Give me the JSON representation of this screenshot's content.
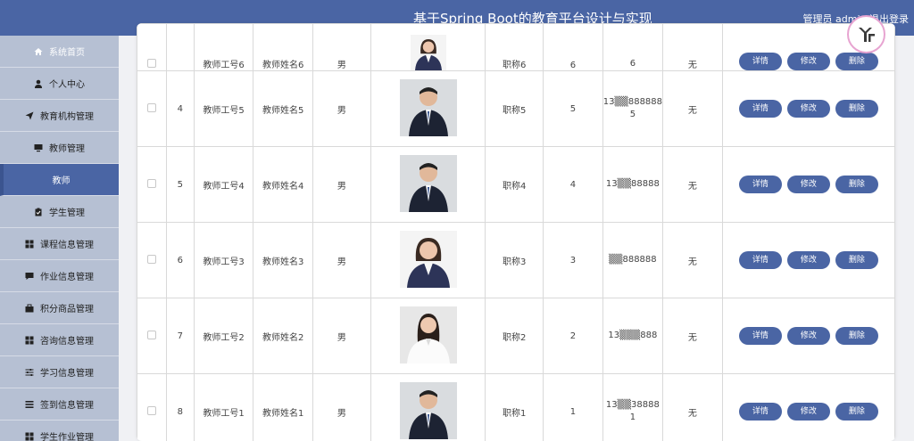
{
  "header": {
    "title": "基于Spring Boot的教育平台设计与实现",
    "user_text": "管理员 admin 退出登录"
  },
  "sidebar": {
    "items": [
      {
        "label": "系统首页",
        "icon": "home-icon"
      },
      {
        "label": "个人中心",
        "icon": "user-icon"
      },
      {
        "label": "教育机构管理",
        "icon": "send-icon"
      },
      {
        "label": "教师管理",
        "icon": "monitor-icon"
      },
      {
        "label": "教师",
        "icon": ""
      },
      {
        "label": "学生管理",
        "icon": "clipboard-icon"
      },
      {
        "label": "课程信息管理",
        "icon": "grid-icon"
      },
      {
        "label": "作业信息管理",
        "icon": "chat-icon"
      },
      {
        "label": "积分商品管理",
        "icon": "bag-icon"
      },
      {
        "label": "咨询信息管理",
        "icon": "grid-icon"
      },
      {
        "label": "学习信息管理",
        "icon": "sliders-icon"
      },
      {
        "label": "签到信息管理",
        "icon": "list-icon"
      },
      {
        "label": "学生作业管理",
        "icon": "grid-icon"
      }
    ]
  },
  "table": {
    "actions": {
      "detail": "详情",
      "edit": "修改",
      "delete": "删除"
    },
    "rows": [
      {
        "index": "",
        "id": "教师工号6",
        "name": "教师姓名6",
        "gender": "男",
        "title": "职称6",
        "level": "6",
        "phone_top": "",
        "phone_bottom": "6",
        "remark": "无",
        "photo": "female"
      },
      {
        "index": "4",
        "id": "教师工号5",
        "name": "教师姓名5",
        "gender": "男",
        "title": "职称5",
        "level": "5",
        "phone_top": "13▒▒888888",
        "phone_bottom": "5",
        "remark": "无",
        "photo": "male"
      },
      {
        "index": "5",
        "id": "教师工号4",
        "name": "教师姓名4",
        "gender": "男",
        "title": "职称4",
        "level": "4",
        "phone_top": "13▒▒88888",
        "phone_bottom": "",
        "remark": "无",
        "photo": "male"
      },
      {
        "index": "6",
        "id": "教师工号3",
        "name": "教师姓名3",
        "gender": "男",
        "title": "职称3",
        "level": "3",
        "phone_top": "▒▒888888",
        "phone_bottom": "",
        "remark": "无",
        "photo": "female"
      },
      {
        "index": "7",
        "id": "教师工号2",
        "name": "教师姓名2",
        "gender": "男",
        "title": "职称2",
        "level": "2",
        "phone_top": "13▒▒▒888",
        "phone_bottom": "",
        "remark": "无",
        "photo": "female-white"
      },
      {
        "index": "8",
        "id": "教师工号1",
        "name": "教师姓名1",
        "gender": "男",
        "title": "职称1",
        "level": "1",
        "phone_top": "13▒▒38888",
        "phone_bottom": "1",
        "remark": "无",
        "photo": "male"
      }
    ]
  },
  "colors": {
    "primary": "#4a65a4",
    "sidebar_bg": "#b6c0d3"
  }
}
